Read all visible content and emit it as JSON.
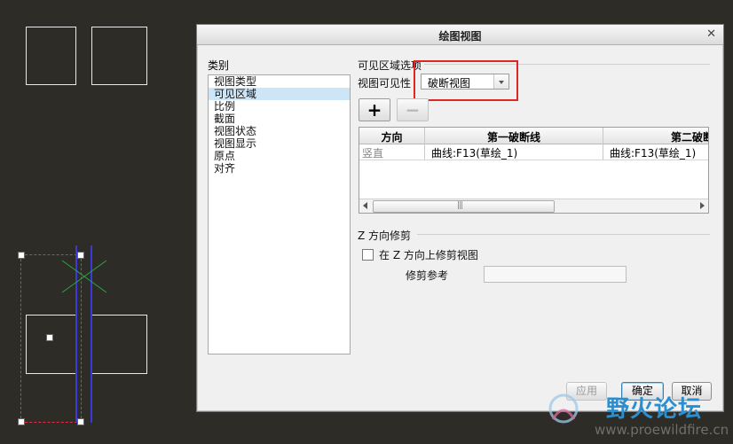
{
  "dialog": {
    "title": "绘图视图",
    "close_icon": "close-icon",
    "categories_label": "类别",
    "categories": [
      {
        "label": "视图类型",
        "selected": false
      },
      {
        "label": "可见区域",
        "selected": true
      },
      {
        "label": "比例",
        "selected": false
      },
      {
        "label": "截面",
        "selected": false
      },
      {
        "label": "视图状态",
        "selected": false
      },
      {
        "label": "视图显示",
        "selected": false
      },
      {
        "label": "原点",
        "selected": false
      },
      {
        "label": "对齐",
        "selected": false
      }
    ],
    "visible_area": {
      "section_title": "可见区域选项",
      "visibility_label": "视图可见性",
      "visibility_value": "破断视图",
      "add_button": "+",
      "remove_button": "−",
      "table": {
        "headers": [
          "方向",
          "第一破断线",
          "第二破断"
        ],
        "rows": [
          [
            "竖直",
            "曲线:F13(草绘_1)",
            "曲线:F13(草绘_1)"
          ]
        ],
        "scroll_grip": "|||"
      }
    },
    "z_trim": {
      "section_title": "Z 方向修剪",
      "checkbox_label": "在 Z 方向上修剪视图",
      "checked": false,
      "trim_ref_label": "修剪参考",
      "trim_ref_value": ""
    },
    "buttons": {
      "apply": "应用",
      "ok": "确定",
      "cancel": "取消"
    }
  },
  "watermark": {
    "title": "野火论坛",
    "url": "www.proewildfire.cn"
  },
  "colors": {
    "canvas_bg": "#2e2c27",
    "selection_frame": "#e0304a",
    "break_line": "#3a3ad8",
    "highlight": "#e02525"
  }
}
